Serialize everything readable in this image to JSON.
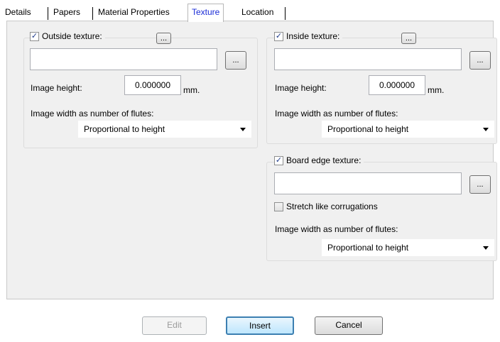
{
  "tabs": [
    "Details",
    "Papers",
    "Material Properties",
    "Texture",
    "Location"
  ],
  "active_tab": "Texture",
  "outside": {
    "checkbox_label": "Outside texture:",
    "checked": true,
    "ellipsis_label": "...",
    "path_value": "",
    "browse_label": "...",
    "image_height_label": "Image height:",
    "image_height_value": "0.000000",
    "unit": "mm.",
    "width_label": "Image width as number of flutes:",
    "width_option": "Proportional to height"
  },
  "inside": {
    "checkbox_label": "Inside texture:",
    "checked": true,
    "ellipsis_label": "...",
    "path_value": "",
    "browse_label": "...",
    "image_height_label": "Image height:",
    "image_height_value": "0.000000",
    "unit": "mm.",
    "width_label": "Image width as number of flutes:",
    "width_option": "Proportional to height"
  },
  "board_edge": {
    "checkbox_label": "Board edge texture:",
    "checked": true,
    "path_value": "",
    "browse_label": "...",
    "stretch_label": "Stretch like corrugations",
    "stretch_checked": false,
    "width_label": "Image width as number of flutes:",
    "width_option": "Proportional to height"
  },
  "buttons": {
    "edit": "Edit",
    "insert": "Insert",
    "cancel": "Cancel"
  }
}
